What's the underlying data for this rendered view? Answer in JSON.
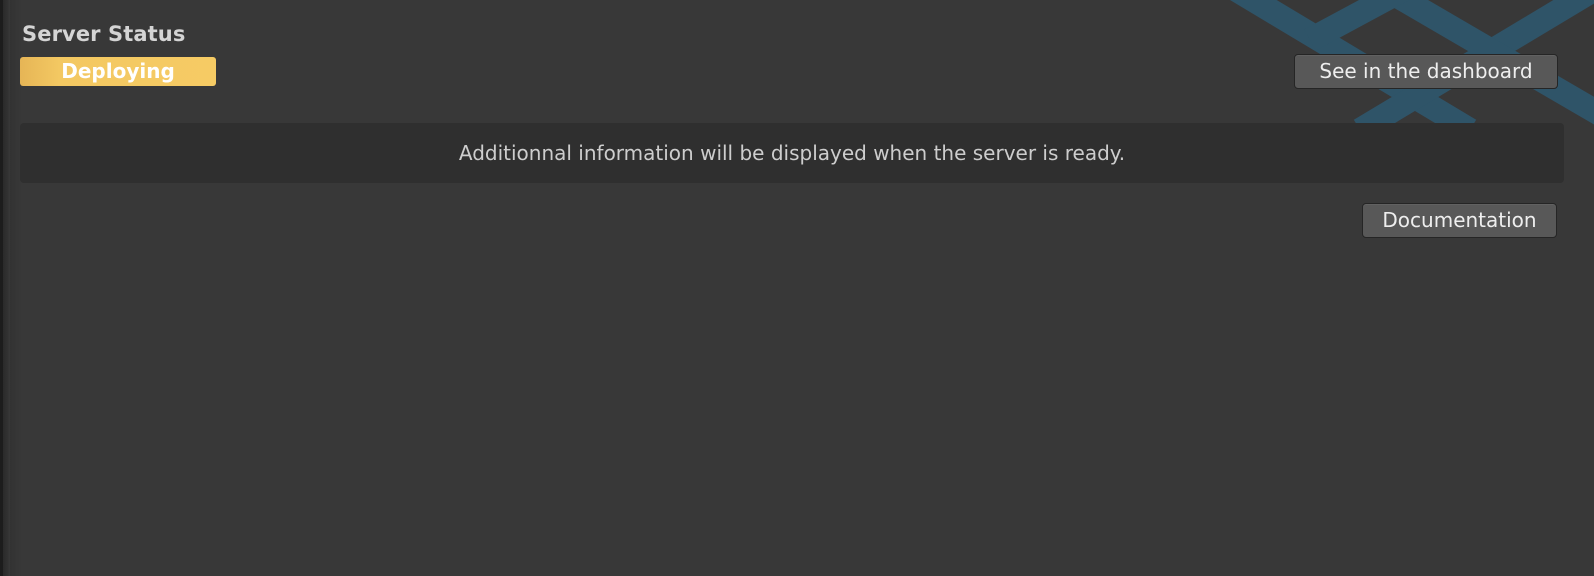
{
  "server_status": {
    "title": "Server Status",
    "status": "Deploying",
    "status_color": "#f6cb64"
  },
  "buttons": {
    "dashboard_label": "See in the dashboard",
    "documentation_label": "Documentation"
  },
  "info": {
    "message": "Additionnal information will be displayed when the server is ready."
  },
  "colors": {
    "background": "#383838",
    "info_box": "#2f2f2f",
    "button": "#585858",
    "brand_graphic": "#2f5468"
  },
  "icons": {
    "brand": "geometric-diamond-graphic"
  }
}
